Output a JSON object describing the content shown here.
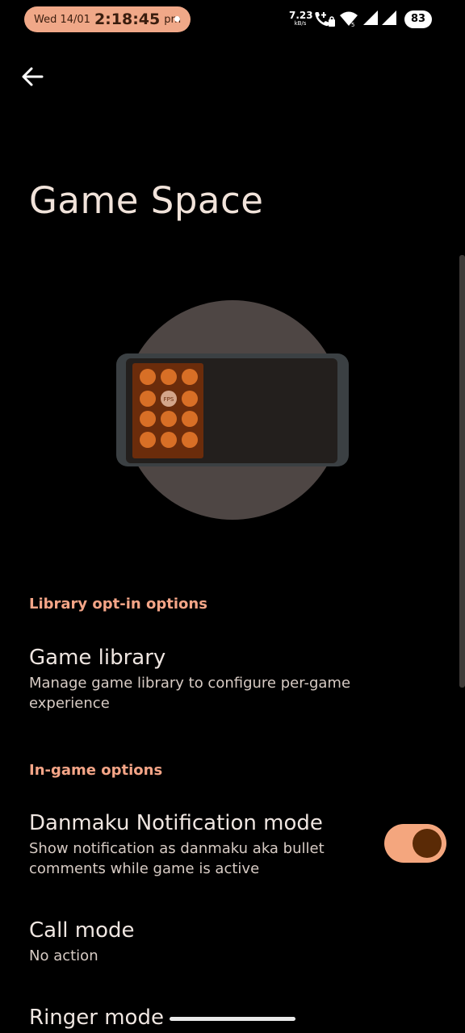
{
  "status_bar": {
    "date": "Wed 14/01",
    "time": "2:18:45",
    "ampm": "pm",
    "net_speed_value": "7.23",
    "net_speed_unit": "kB/s",
    "battery": "83",
    "icons": [
      "notification-dot-icon",
      "volte-call-icon",
      "wifi-icon",
      "signal-icon",
      "signal-icon-2",
      "battery-icon"
    ]
  },
  "header": {
    "back_icon": "arrow-left-icon",
    "title": "Game Space"
  },
  "illustration": {
    "fps_label": "FPS",
    "icon": "game-panel-illustration"
  },
  "sections": {
    "library": {
      "header": "Library opt-in options",
      "game_library": {
        "title": "Game library",
        "summary": "Manage game library to configure per-game experience"
      }
    },
    "in_game": {
      "header": "In-game options",
      "danmaku": {
        "title": "Danmaku Notification mode",
        "summary": "Show notification as danmaku aka bullet comments while game is active",
        "enabled": true
      },
      "call_mode": {
        "title": "Call mode",
        "summary": "No action"
      },
      "ringer_mode": {
        "title": "Ringer mode"
      }
    }
  },
  "colors": {
    "accent": "#f4a587",
    "toggle_track": "#f4a67e",
    "toggle_knob": "#5a2a06",
    "background": "#000000",
    "status_pill": "#f0a888"
  }
}
